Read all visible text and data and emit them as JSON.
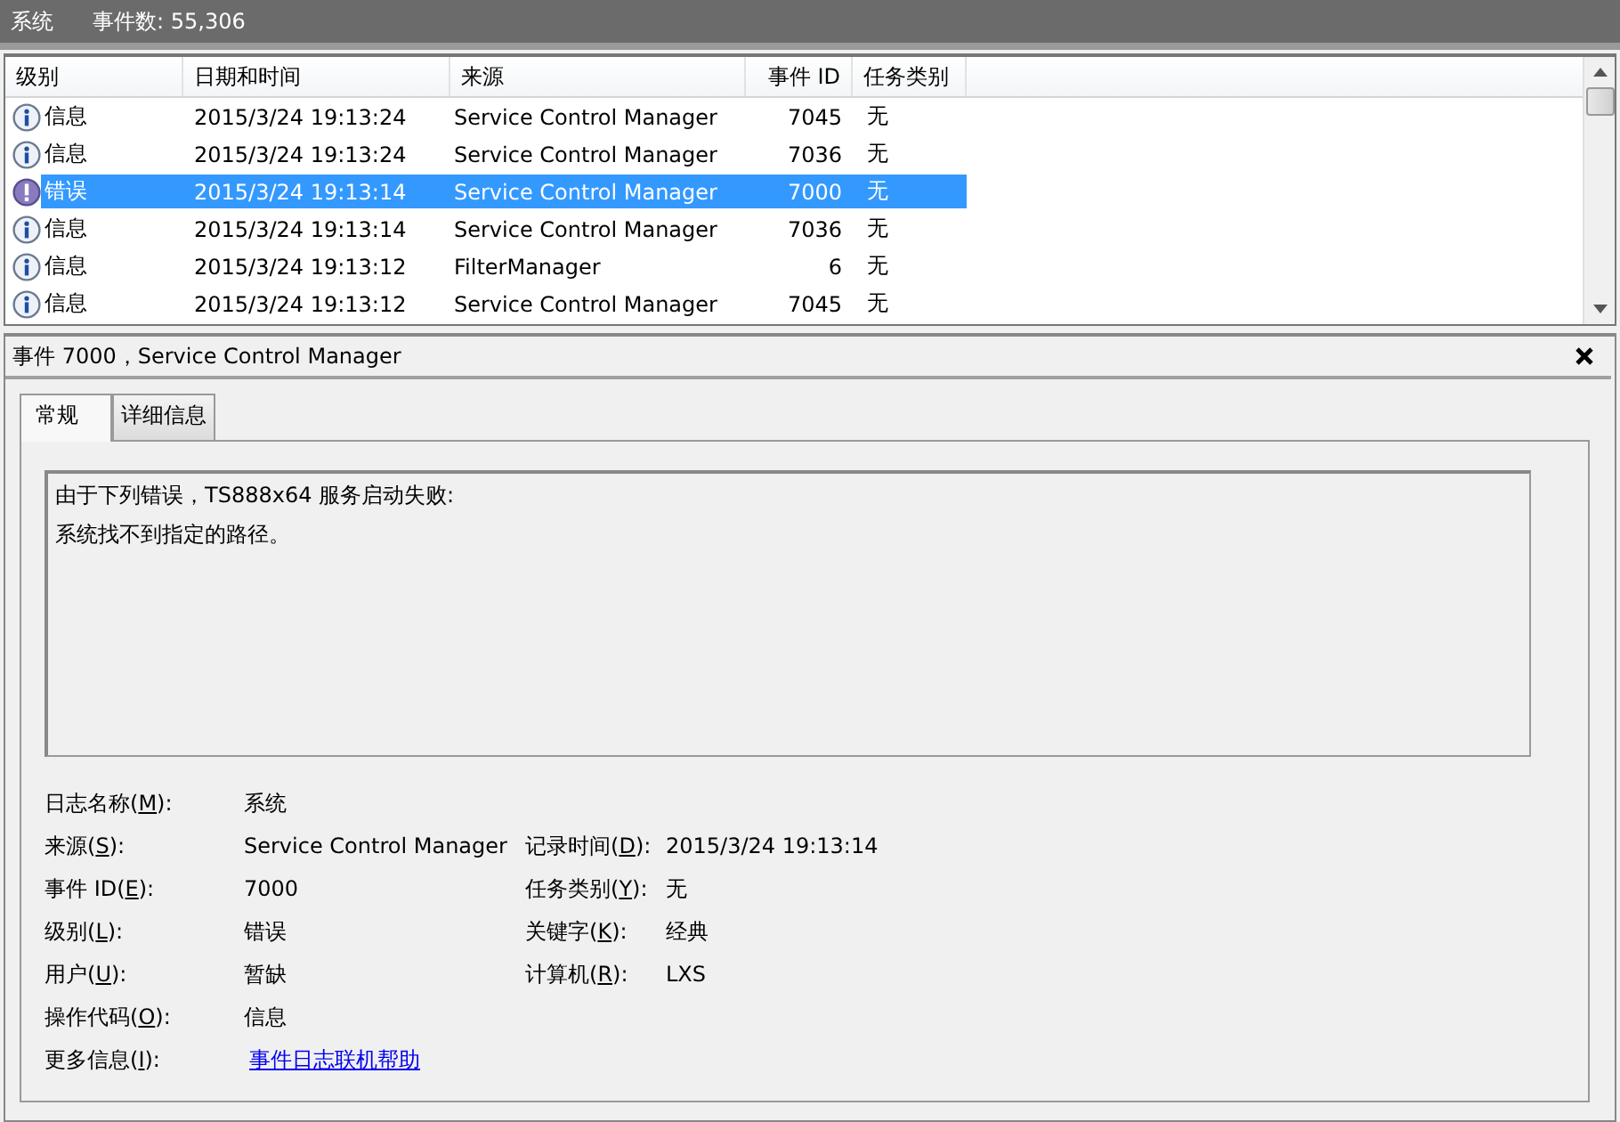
{
  "top_bar": {
    "title": "系统",
    "count": "事件数: 55,306"
  },
  "table": {
    "columns": [
      {
        "label": "级别"
      },
      {
        "label": "日期和时间"
      },
      {
        "label": "来源"
      },
      {
        "label": "事件 ID"
      },
      {
        "label": "任务类别"
      }
    ],
    "rows": [
      {
        "kind": "info",
        "level": "信息",
        "date": "2015/3/24 19:13:24",
        "source": "Service Control Manager",
        "id": "7045",
        "task": "无",
        "selected": false
      },
      {
        "kind": "info",
        "level": "信息",
        "date": "2015/3/24 19:13:24",
        "source": "Service Control Manager",
        "id": "7036",
        "task": "无",
        "selected": false
      },
      {
        "kind": "error",
        "level": "错误",
        "date": "2015/3/24 19:13:14",
        "source": "Service Control Manager",
        "id": "7000",
        "task": "无",
        "selected": true
      },
      {
        "kind": "info",
        "level": "信息",
        "date": "2015/3/24 19:13:14",
        "source": "Service Control Manager",
        "id": "7036",
        "task": "无",
        "selected": false
      },
      {
        "kind": "info",
        "level": "信息",
        "date": "2015/3/24 19:13:12",
        "source": "FilterManager",
        "id": "6",
        "task": "无",
        "selected": false
      },
      {
        "kind": "info",
        "level": "信息",
        "date": "2015/3/24 19:13:12",
        "source": "Service Control Manager",
        "id": "7045",
        "task": "无",
        "selected": false
      }
    ]
  },
  "detail": {
    "title": "事件 7000，Service Control Manager",
    "tabs": [
      {
        "label": "常规",
        "selected": true
      },
      {
        "label": "详细信息",
        "selected": false
      }
    ],
    "message": [
      "由于下列错误，TS888x64 服务启动失败:",
      "系统找不到指定的路径。"
    ],
    "fields": [
      {
        "left": {
          "before": "日志名称(",
          "key": "M",
          "after": "):",
          "value": "系统"
        }
      },
      {
        "left": {
          "before": "来源(",
          "key": "S",
          "after": "):",
          "value": "Service Control Manager"
        },
        "right": {
          "before": "记录时间(",
          "key": "D",
          "after": "):",
          "value": "2015/3/24 19:13:14"
        }
      },
      {
        "left": {
          "before": "事件 ID(",
          "key": "E",
          "after": "):",
          "value": "7000"
        },
        "right": {
          "before": "任务类别(",
          "key": "Y",
          "after": "):",
          "value": "无"
        }
      },
      {
        "left": {
          "before": "级别(",
          "key": "L",
          "after": "):",
          "value": "错误"
        },
        "right": {
          "before": "关键字(",
          "key": "K",
          "after": "):",
          "value": "经典"
        }
      },
      {
        "left": {
          "before": "用户(",
          "key": "U",
          "after": "):",
          "value": "暂缺"
        },
        "right": {
          "before": "计算机(",
          "key": "R",
          "after": "):",
          "value": "LXS"
        }
      },
      {
        "left": {
          "before": "操作代码(",
          "key": "O",
          "after": "):",
          "value": "信息"
        }
      },
      {
        "left": {
          "before": "更多信息(",
          "key": "I",
          "after": "):",
          "value": "事件日志联机帮助",
          "kind": "link"
        }
      }
    ]
  }
}
